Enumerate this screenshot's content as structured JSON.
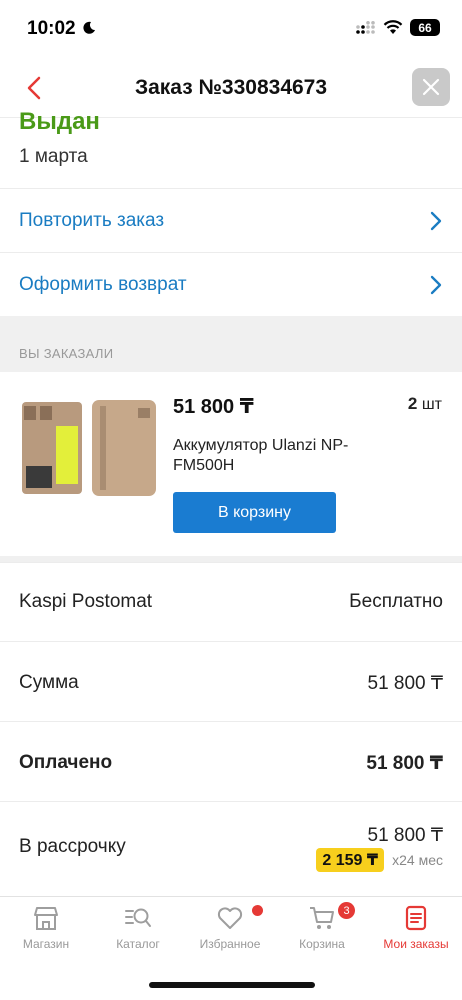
{
  "status_bar": {
    "time": "10:02",
    "battery": "66"
  },
  "header": {
    "title": "Заказ №330834673"
  },
  "order": {
    "status": "Выдан",
    "date": "1 марта"
  },
  "actions": [
    {
      "label": "Повторить заказ"
    },
    {
      "label": "Оформить возврат"
    }
  ],
  "section": {
    "ordered_label": "ВЫ ЗАКАЗАЛИ"
  },
  "product": {
    "price": "51 800 ₸",
    "qty_number": "2",
    "qty_unit": "шт",
    "name": "Аккумулятор Ulanzi NP-FM500H",
    "cart_button": "В корзину"
  },
  "summary": {
    "delivery_label": "Kaspi Postomat",
    "delivery_value": "Бесплатно",
    "sum_label": "Сумма",
    "sum_value": "51 800 ₸",
    "paid_label": "Оплачено",
    "paid_value": "51 800 ₸",
    "installment_label": "В рассрочку",
    "installment_value": "51 800 ₸",
    "installment_monthly": "2 159 ₸",
    "installment_term": "x24 мес"
  },
  "tabs": [
    {
      "label": "Магазин"
    },
    {
      "label": "Каталог"
    },
    {
      "label": "Избранное"
    },
    {
      "label": "Корзина"
    },
    {
      "label": "Мои заказы"
    }
  ],
  "cart_badge": "3",
  "colors": {
    "accent": "#1a7cd1",
    "status_green": "#4a9a18",
    "active_tab": "#e53935",
    "badge_yellow": "#f7cf1d"
  }
}
